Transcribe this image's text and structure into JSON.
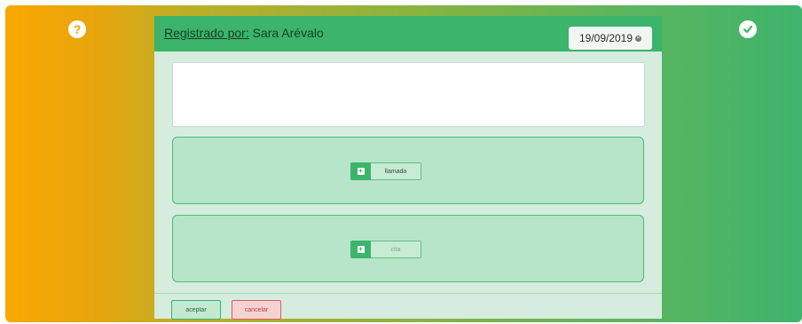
{
  "header": {
    "registrado_label": "Registrado por:",
    "registrado_name": " Sara Arévalo",
    "date": "19/09/2019"
  },
  "icons": {
    "help": "question-circle",
    "confirm": "check-circle",
    "date_clear": "x-circle",
    "add": "plus-square"
  },
  "note": {
    "value": ""
  },
  "groups": [
    {
      "button_label": "llamada",
      "enabled": true
    },
    {
      "button_label": "cita",
      "enabled": false
    }
  ],
  "footer": {
    "accept_label": "aceptar",
    "cancel_label": "cancelar"
  },
  "colors": {
    "accent": "#3cb46b",
    "gradient_start": "#f9a800",
    "gradient_end": "#3fb46c",
    "cancel": "#e25c5c"
  }
}
